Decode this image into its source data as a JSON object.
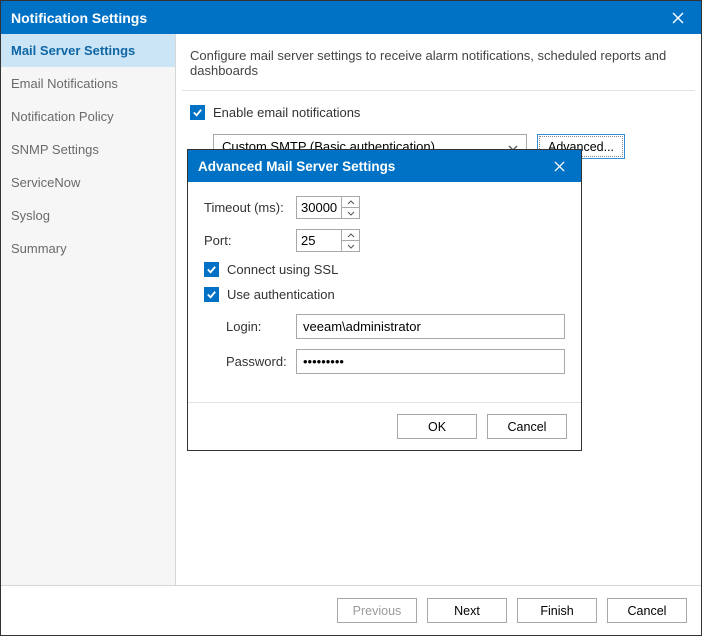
{
  "window": {
    "title": "Notification Settings"
  },
  "sidebar": {
    "items": [
      {
        "label": "Mail Server Settings",
        "selected": true
      },
      {
        "label": "Email Notifications"
      },
      {
        "label": "Notification Policy"
      },
      {
        "label": "SNMP Settings"
      },
      {
        "label": "ServiceNow"
      },
      {
        "label": "Syslog"
      },
      {
        "label": "Summary"
      }
    ]
  },
  "main": {
    "description": "Configure mail server settings to receive alarm notifications, scheduled reports and dashboards",
    "enable_label": "Enable email notifications",
    "smtp_selected": "Custom SMTP (Basic authentication)",
    "advanced_button": "Advanced..."
  },
  "dialog": {
    "title": "Advanced Mail Server Settings",
    "timeout_label": "Timeout (ms):",
    "timeout_value": "30000",
    "port_label": "Port:",
    "port_value": "25",
    "ssl_label": "Connect using SSL",
    "auth_label": "Use authentication",
    "login_label": "Login:",
    "login_value": "veeam\\administrator",
    "password_label": "Password:",
    "password_value": "•••••••••",
    "ok": "OK",
    "cancel": "Cancel"
  },
  "footer": {
    "previous": "Previous",
    "next": "Next",
    "finish": "Finish",
    "cancel": "Cancel"
  }
}
